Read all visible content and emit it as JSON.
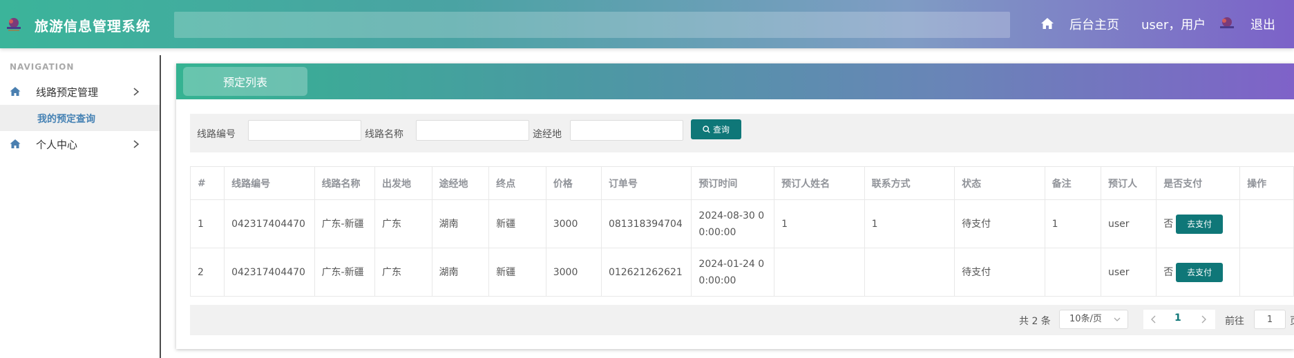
{
  "header": {
    "app_title": "旅游信息管理系统",
    "home_label": "后台主页",
    "user_label": "user，用户",
    "logout_label": "退出"
  },
  "sidebar": {
    "heading": "NAVIGATION",
    "items": [
      {
        "label": "线路预定管理",
        "icon": "home-icon",
        "expanded": true,
        "children": [
          {
            "label": "我的预定查询",
            "active": true
          }
        ]
      },
      {
        "label": "个人中心",
        "icon": "home-icon",
        "expanded": false
      }
    ]
  },
  "panel": {
    "active_tab": "预定列表",
    "filters": [
      {
        "label": "线路编号",
        "value": "",
        "placeholder": ""
      },
      {
        "label": "线路名称",
        "value": "",
        "placeholder": ""
      },
      {
        "label": "途经地",
        "value": "",
        "placeholder": ""
      }
    ],
    "query_button": "查询"
  },
  "table": {
    "columns": [
      "#",
      "线路编号",
      "线路名称",
      "出发地",
      "途经地",
      "终点",
      "价格",
      "订单号",
      "预订时间",
      "预订人姓名",
      "联系方式",
      "状态",
      "备注",
      "预订人",
      "是否支付",
      "操作"
    ],
    "rows": [
      {
        "index": "1",
        "route_no": "042317404470",
        "route_name": "广东-新疆",
        "origin": "广东",
        "via": "湖南",
        "destination": "新疆",
        "price": "3000",
        "order_no": "081318394704",
        "booked_at": "2024-08-30 00:00:00",
        "booker_name": "1",
        "contact": "1",
        "status": "待支付",
        "remark": "1",
        "booker": "user",
        "paid": "否",
        "pay_button": "去支付"
      },
      {
        "index": "2",
        "route_no": "042317404470",
        "route_name": "广东-新疆",
        "origin": "广东",
        "via": "湖南",
        "destination": "新疆",
        "price": "3000",
        "order_no": "012621262621",
        "booked_at": "2024-01-24 00:00:00",
        "booker_name": "",
        "contact": "",
        "status": "待支付",
        "remark": "",
        "booker": "user",
        "paid": "否",
        "pay_button": "去支付"
      }
    ]
  },
  "pagination": {
    "total": "共 2 条",
    "page_size": "10条/页",
    "current_page": "1",
    "goto_prefix": "前往",
    "goto_value": "1",
    "goto_suffix": "页"
  },
  "colors": {
    "accent": "#0f7778",
    "sidebar_active_text": "#4682b4"
  }
}
